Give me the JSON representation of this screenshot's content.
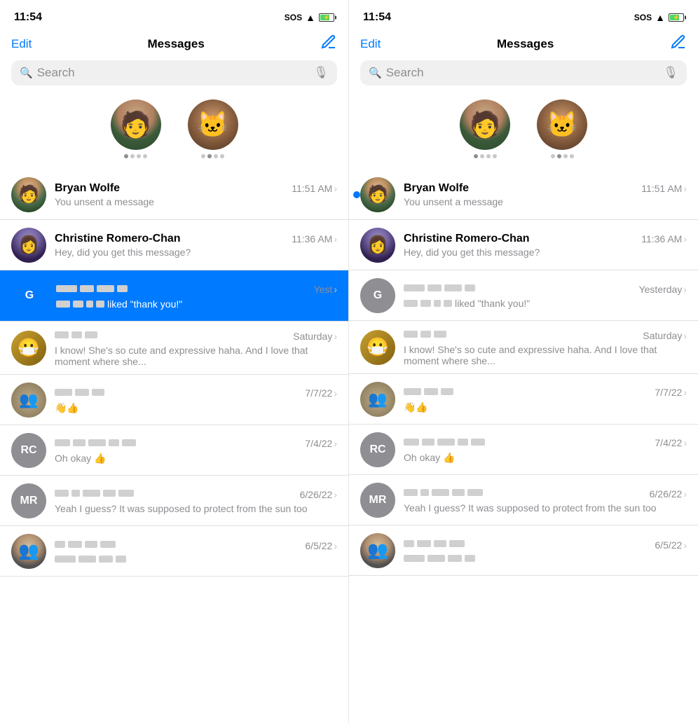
{
  "panels": [
    {
      "id": "left",
      "statusBar": {
        "time": "11:54",
        "sos": "SOS",
        "wifi": true,
        "battery": true
      },
      "nav": {
        "edit": "Edit",
        "title": "Messages",
        "compose": true
      },
      "search": {
        "placeholder": "Search"
      },
      "pinned": [
        {
          "id": "pinned-1",
          "type": "man",
          "dots": [
            true,
            false,
            false,
            false
          ]
        },
        {
          "id": "pinned-2",
          "type": "cat",
          "dots": [
            false,
            true,
            false,
            false
          ]
        }
      ],
      "conversations": [
        {
          "id": "conv-1",
          "name": "Bryan Wolfe",
          "time": "11:51 AM",
          "preview": "You unsent a message",
          "avatarType": "photo-man",
          "unread": false,
          "highlighted": false,
          "previewLines": 1
        },
        {
          "id": "conv-2",
          "name": "Christine Romero-Chan",
          "time": "11:36 AM",
          "preview": "Hey, did you get this message?",
          "avatarType": "photo-woman",
          "unread": false,
          "highlighted": false,
          "previewLines": 1
        },
        {
          "id": "conv-3",
          "name": "",
          "time": "Yest",
          "preview": "liked \"thank you!\"",
          "avatarType": "G",
          "avatarColor": "grey",
          "unread": false,
          "highlighted": true,
          "redactedName": [
            30,
            20,
            25,
            15
          ],
          "redactedPrefix": true,
          "previewLines": 1
        },
        {
          "id": "conv-4",
          "name": "",
          "time": "Saturday",
          "preview": "I know! She's so cute and expressive haha. And I love that moment where she...",
          "avatarType": "mask",
          "unread": false,
          "highlighted": false,
          "redactedName": [
            20,
            15,
            18
          ],
          "previewLines": 2
        },
        {
          "id": "conv-5",
          "name": "",
          "time": "7/7/22",
          "preview": "👋👍",
          "avatarType": "group",
          "unread": false,
          "highlighted": false,
          "redactedName": [
            25,
            20,
            18
          ],
          "previewLines": 1
        },
        {
          "id": "conv-6",
          "name": "",
          "time": "7/4/22",
          "preview": "Oh okay 👍",
          "avatarType": "RC",
          "avatarColor": "grey",
          "unread": false,
          "highlighted": false,
          "redactedName": [
            22,
            18,
            25,
            15,
            20
          ],
          "previewLines": 1
        },
        {
          "id": "conv-7",
          "name": "",
          "time": "6/26/22",
          "preview": "Yeah I guess? It was supposed to protect from the sun too",
          "avatarType": "MR",
          "avatarColor": "grey",
          "unread": false,
          "highlighted": false,
          "redactedName": [
            20,
            12,
            25,
            18,
            22
          ],
          "previewLines": 2
        },
        {
          "id": "conv-8",
          "name": "",
          "time": "6/5/22",
          "preview": "",
          "avatarType": "photo-man2",
          "unread": false,
          "highlighted": false,
          "redactedName": [
            15,
            20,
            18,
            22
          ],
          "previewLines": 1
        }
      ]
    },
    {
      "id": "right",
      "statusBar": {
        "time": "11:54",
        "sos": "SOS",
        "wifi": true,
        "battery": true
      },
      "nav": {
        "edit": "Edit",
        "title": "Messages",
        "compose": true
      },
      "search": {
        "placeholder": "Search"
      },
      "pinned": [
        {
          "id": "pinned-r1",
          "type": "man",
          "dots": [
            true,
            false,
            false,
            false
          ]
        },
        {
          "id": "pinned-r2",
          "type": "cat",
          "dots": [
            false,
            true,
            false,
            false
          ]
        }
      ],
      "conversations": [
        {
          "id": "r-conv-1",
          "name": "Bryan Wolfe",
          "time": "11:51 AM",
          "preview": "You unsent a message",
          "avatarType": "photo-man",
          "unread": true,
          "highlighted": false,
          "previewLines": 1
        },
        {
          "id": "r-conv-2",
          "name": "Christine Romero-Chan",
          "time": "11:36 AM",
          "preview": "Hey, did you get this message?",
          "avatarType": "photo-woman",
          "unread": false,
          "highlighted": false,
          "previewLines": 1
        },
        {
          "id": "r-conv-3",
          "name": "",
          "time": "Yesterday",
          "preview": "liked \"thank you!\"",
          "avatarType": "G",
          "avatarColor": "grey",
          "unread": false,
          "highlighted": false,
          "redactedName": [
            30,
            20,
            25,
            15
          ],
          "redactedPrefix": true,
          "previewLines": 1
        },
        {
          "id": "r-conv-4",
          "name": "",
          "time": "Saturday",
          "preview": "I know! She's so cute and expressive haha. And I love that moment where she...",
          "avatarType": "mask",
          "unread": false,
          "highlighted": false,
          "redactedName": [
            20,
            15,
            18
          ],
          "previewLines": 2
        },
        {
          "id": "r-conv-5",
          "name": "",
          "time": "7/7/22",
          "preview": "👋👍",
          "avatarType": "group",
          "unread": false,
          "highlighted": false,
          "redactedName": [
            25,
            20,
            18
          ],
          "previewLines": 1
        },
        {
          "id": "r-conv-6",
          "name": "",
          "time": "7/4/22",
          "preview": "Oh okay 👍",
          "avatarType": "RC",
          "avatarColor": "grey",
          "unread": false,
          "highlighted": false,
          "redactedName": [
            22,
            18,
            25,
            15,
            20
          ],
          "previewLines": 1
        },
        {
          "id": "r-conv-7",
          "name": "",
          "time": "6/26/22",
          "preview": "Yeah I guess? It was supposed to protect from the sun too",
          "avatarType": "MR",
          "avatarColor": "grey",
          "unread": false,
          "highlighted": false,
          "redactedName": [
            20,
            12,
            25,
            18,
            22
          ],
          "previewLines": 2
        },
        {
          "id": "r-conv-8",
          "name": "",
          "time": "6/5/22",
          "preview": "",
          "avatarType": "photo-man2",
          "unread": false,
          "highlighted": false,
          "redactedName": [
            15,
            20,
            18,
            22
          ],
          "previewLines": 1
        }
      ]
    }
  ]
}
